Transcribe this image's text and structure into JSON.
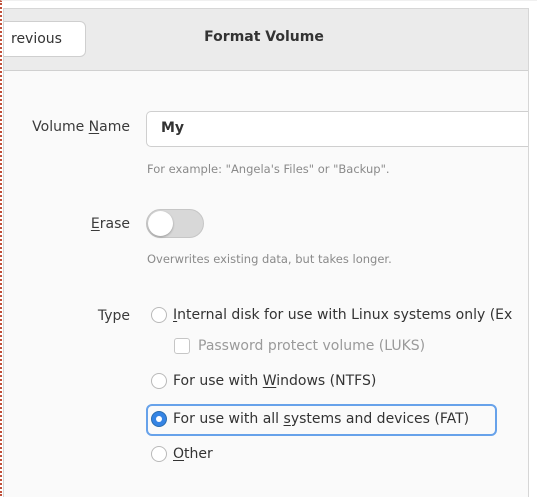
{
  "header": {
    "previous_label": "revious",
    "title": "Format Volume"
  },
  "volume_name": {
    "label_pre": "Volume ",
    "label_u": "N",
    "label_post": "ame",
    "value": "My",
    "hint": "For example: \"Angela's Files\" or \"Backup\"."
  },
  "erase": {
    "label_u": "E",
    "label_post": "rase",
    "state": "off",
    "hint": "Overwrites existing data, but takes longer."
  },
  "type": {
    "label": "Type",
    "options": [
      {
        "pre": "",
        "u": "I",
        "post": "nternal disk for use with Linux systems only (Ex",
        "checked": false
      },
      {
        "pre": "For use with ",
        "u": "W",
        "post": "indows (NTFS)",
        "checked": false
      },
      {
        "pre": "For use with all ",
        "u": "s",
        "post": "ystems and devices (FAT)",
        "checked": true
      },
      {
        "pre": "",
        "u": "O",
        "post": "ther",
        "checked": false
      }
    ],
    "password_label": "Password protect volume (LUKS)"
  },
  "colors": {
    "accent": "#3584e4"
  }
}
